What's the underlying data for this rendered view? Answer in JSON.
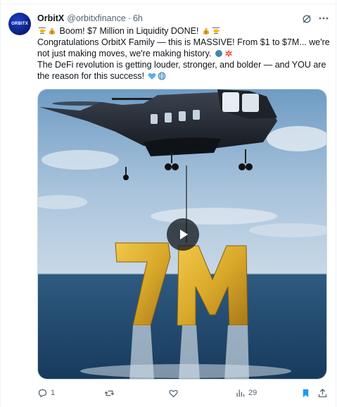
{
  "tweet": {
    "author_name": "OrbitX",
    "author_handle": "@orbitxfinance",
    "separator": "·",
    "time": "6h",
    "avatar_label": "ORBITX",
    "lines": [
      "Boom! $7 Million in Liquidity DONE!",
      "Congratulations OrbitX Family — this is MASSIVE! From $1 to $7M... we're",
      "not just making moves, we're making history.",
      "The DeFi revolution is getting louder, stronger, and bolder — and YOU are",
      "the reason for this success!"
    ],
    "media": {
      "overlay_text": "7M"
    },
    "actions": {
      "reply_count": "1",
      "repost_count": "",
      "like_count": "",
      "views_count": "29"
    }
  },
  "icons": {
    "grok": "grok-icon",
    "more": "more-icon",
    "reply": "reply-icon",
    "repost": "repost-icon",
    "like": "like-icon",
    "views": "views-icon",
    "bookmark": "bookmark-icon",
    "share": "share-icon",
    "play": "play-icon"
  },
  "colors": {
    "text": "#0f1419",
    "muted": "#536471",
    "accent": "#1d9bf0",
    "avatar": "#0b1d7a",
    "gold": "#d9a92a"
  }
}
